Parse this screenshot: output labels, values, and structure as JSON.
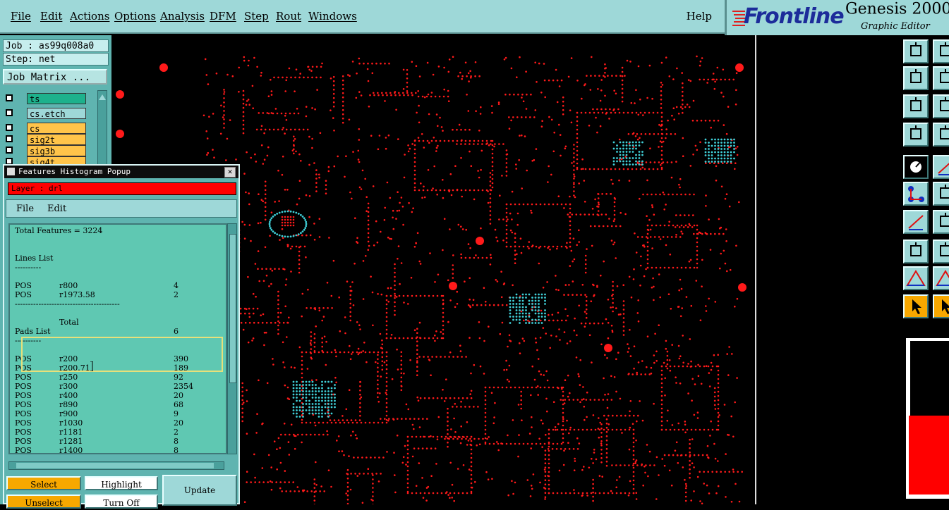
{
  "menubar": {
    "items": [
      "File",
      "Edit",
      "Actions",
      "Options",
      "Analysis",
      "DFM",
      "Step",
      "Rout",
      "Windows"
    ],
    "help": "Help"
  },
  "logo": {
    "brand": "Frontline",
    "product": "Genesis 2000",
    "product_suffix": "°",
    "subtitle": "Graphic Editor"
  },
  "leftpanel": {
    "job": "Job : as99q008a0",
    "step": "Step: net",
    "job_matrix": "Job Matrix ...",
    "layers": [
      {
        "name": "ts",
        "color": "#1db18c"
      },
      {
        "name": "cs.etch",
        "color": "#9ed8d8"
      },
      {
        "name": "cs",
        "color": "#ffc44a"
      },
      {
        "name": "sig2t",
        "color": "#ffc44a"
      },
      {
        "name": "sig3b",
        "color": "#ffc44a"
      },
      {
        "name": "sig4t",
        "color": "#ffc44a"
      }
    ]
  },
  "popup": {
    "title": "Features Histogram Popup",
    "close_glyph": "✕",
    "layer_label": "Layer :  drl",
    "menu": [
      "File",
      "Edit"
    ],
    "total": "Total Features = 3224",
    "lines_header": "Lines List",
    "separator_short": "----------",
    "lines": [
      {
        "pol": "POS",
        "sym": "r800",
        "count": "4"
      },
      {
        "pol": "POS",
        "sym": "r1973.58",
        "count": "2"
      }
    ],
    "separator_long": "----------------------------------------",
    "total_label": "Total",
    "lines_total": "6",
    "pads_header": "Pads List",
    "pads": [
      {
        "pol": "POS",
        "sym": "r200",
        "count": "390"
      },
      {
        "pol": "POS",
        "sym": "r200.71",
        "count": "189"
      },
      {
        "pol": "POS",
        "sym": "r250",
        "count": "92"
      },
      {
        "pol": "POS",
        "sym": "r300",
        "count": "2354"
      },
      {
        "pol": "POS",
        "sym": "r400",
        "count": "20"
      },
      {
        "pol": "POS",
        "sym": "r890",
        "count": "68"
      },
      {
        "pol": "POS",
        "sym": "r900",
        "count": "9"
      },
      {
        "pol": "POS",
        "sym": "r1030",
        "count": "20"
      },
      {
        "pol": "POS",
        "sym": "r1181",
        "count": "2"
      },
      {
        "pol": "POS",
        "sym": "r1281",
        "count": "8"
      },
      {
        "pol": "POS",
        "sym": "r1400",
        "count": "8"
      }
    ],
    "buttons": {
      "select": "Select",
      "highlight": "Highlight",
      "update": "Update",
      "unselect": "Unselect",
      "turn_off": "Turn Off"
    }
  },
  "colors": {
    "panel": "#5fb4b0",
    "menubar": "#9ed8d8",
    "via_red": "#ff1a1a",
    "pad_cyan": "#40d0d8",
    "active_tool": "#f7a800"
  },
  "toolbar_icons": [
    "load-icon",
    "open-icon",
    "step-icon",
    "window-icon",
    "zoom-fit-icon",
    "zoom-area-icon",
    "measure-icon",
    "grid-icon",
    "net-icon",
    "line-icon",
    "connect-icon",
    "cross-icon",
    "route-icon",
    "arc-icon",
    "pad-icon",
    "split-icon",
    "triangle-icon",
    "delta-icon",
    "pointer-icon",
    "select-icon"
  ]
}
